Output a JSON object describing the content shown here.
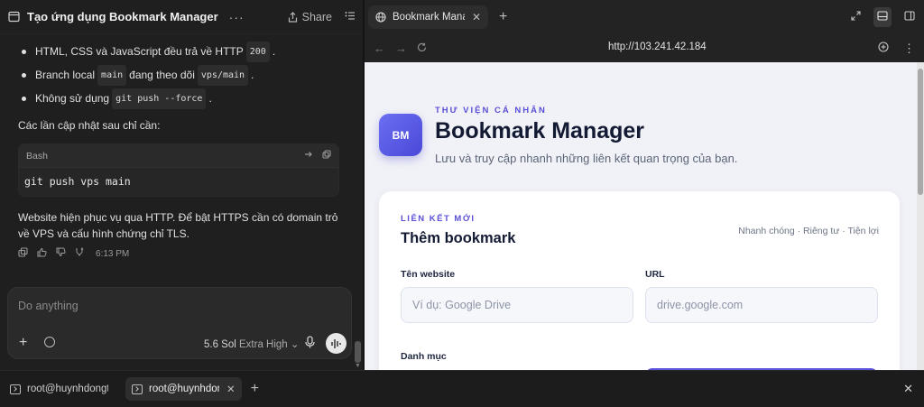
{
  "left": {
    "title": "Tạo ứng dụng Bookmark Manager",
    "more": "···",
    "share": "Share",
    "bullets": [
      {
        "pre": "HTML, CSS và JavaScript đều trả về HTTP ",
        "code": "200",
        "post": "."
      },
      {
        "pre": "Branch local ",
        "code": "main",
        "mid": " đang theo dõi ",
        "code2": "vps/main",
        "post": "."
      },
      {
        "pre": "Không sử dụng ",
        "code": "git push --force",
        "post": "."
      }
    ],
    "para1": "Các lần cập nhật sau chỉ cần:",
    "code_block": {
      "lang": "Bash",
      "code": "git push vps main"
    },
    "para2": "Website hiện phục vụ qua HTTP. Để bật HTTPS cần có domain trỏ về VPS và cấu hình chứng chỉ TLS.",
    "timestamp": "6:13 PM",
    "composer": {
      "placeholder": "Do anything",
      "model": "5.6 Sol",
      "effort": "Extra High"
    }
  },
  "browser": {
    "tab_label": "Bookmark Manager",
    "url": "http://103.241.42.184"
  },
  "page": {
    "eyebrow": "THƯ VIỆN CÁ NHÂN",
    "logo_text": "BM",
    "title": "Bookmark Manager",
    "subtitle": "Lưu và truy cập nhanh những liên kết quan trọng của bạn.",
    "card": {
      "eyebrow": "LIÊN KẾT MỚI",
      "title": "Thêm bookmark",
      "tags": "Nhanh chóng · Riêng tư · Tiện lợi",
      "name_label": "Tên website",
      "name_placeholder": "Ví dụ: Google Drive",
      "url_label": "URL",
      "url_placeholder": "drive.google.com",
      "category_label": "Danh mục"
    },
    "accent": "#5a4fd6"
  },
  "terminal": {
    "tabs": [
      {
        "label": "root@huynhdongth"
      },
      {
        "label": "root@huynhdon"
      }
    ]
  }
}
